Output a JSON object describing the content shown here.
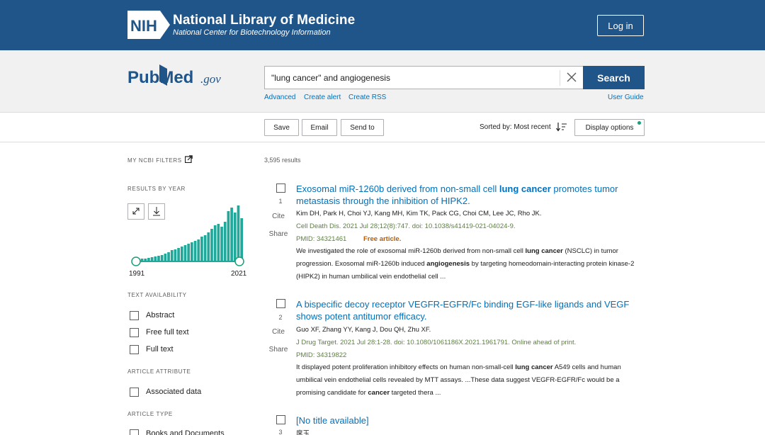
{
  "header": {
    "logo_text": "NIH",
    "title": "National Library of Medicine",
    "subtitle": "National Center for Biotechnology Information",
    "login_label": "Log in"
  },
  "search": {
    "logo_text": "PubMed",
    "logo_suffix": ".gov",
    "query": "\"lung cancer\" and angiogenesis",
    "button_label": "Search",
    "links": [
      "Advanced",
      "Create alert",
      "Create RSS"
    ],
    "user_guide": "User Guide"
  },
  "toolbar": {
    "save": "Save",
    "email": "Email",
    "send_to": "Send to",
    "sorted_by": "Sorted by: Most recent",
    "display_options": "Display options"
  },
  "sidebar": {
    "my_filters": "MY NCBI FILTERS",
    "results_by_year": "RESULTS BY YEAR",
    "year_start": "1991",
    "year_end": "2021",
    "text_availability": "TEXT AVAILABILITY",
    "text_options": [
      "Abstract",
      "Free full text",
      "Full text"
    ],
    "article_attribute": "ARTICLE ATTRIBUTE",
    "attribute_options": [
      "Associated data"
    ],
    "article_type": "ARTICLE TYPE",
    "type_options": [
      "Books and Documents"
    ]
  },
  "chart_data": {
    "type": "bar",
    "title": "",
    "series_color": "#20a89a",
    "values": [
      2,
      3,
      3,
      4,
      5,
      6,
      7,
      8,
      10,
      12,
      15,
      16,
      18,
      20,
      22,
      24,
      26,
      28,
      30,
      34,
      36,
      40,
      45,
      50,
      52,
      48,
      55,
      70,
      75,
      68,
      78,
      60
    ]
  },
  "results": {
    "count": "3,595 results",
    "cite": "Cite",
    "share": "Share",
    "free_article": "Free article.",
    "items": [
      {
        "num": "1",
        "title_pre": "Exosomal miR-1260b derived from non-small cell ",
        "title_bold": "lung cancer",
        "title_post": " promotes tumor metastasis through the inhibition of HIPK2.",
        "authors": "Kim DH, Park H, Choi YJ, Kang MH, Kim TK, Pack CG, Choi CM, Lee JC, Rho JK.",
        "citation": "Cell Death Dis. 2021 Jul 28;12(8):747. doi: 10.1038/s41419-021-04024-9.",
        "pmid": "PMID: 34321461",
        "snip_1": "We investigated the role of exosomal miR-1260b derived from non-small cell ",
        "snip_1b": "lung cancer",
        "snip_2": " (NSCLC) in tumor progression. Exosomal miR-1260b induced ",
        "snip_2b": "angiogenesis",
        "snip_3": " by targeting homeodomain-interacting protein kinase-2 (HIPK2) in human umbilical vein endothelial cell ..."
      },
      {
        "num": "2",
        "title": "A bispecific decoy receptor VEGFR-EGFR/Fc binding EGF-like ligands and VEGF shows potent antitumor efficacy.",
        "authors": "Guo XF, Zhang YY, Kang J, Dou QH, Zhu XF.",
        "citation": "J Drug Target. 2021 Jul 28:1-28. doi: 10.1080/1061186X.2021.1961791. Online ahead of print.",
        "pmid": "PMID: 34319822",
        "snip_1": "It displayed potent proliferation inhibitory effects on human non-small-cell ",
        "snip_1b": "lung cancer",
        "snip_2": " A549 cells and human umbilical vein endothelial cells revealed by MTT assays. ...These data suggest VEGFR-EGFR/Fc would be a promising candidate for ",
        "snip_2b": "cancer",
        "snip_3": " targeted thera ..."
      },
      {
        "num": "3",
        "title": "[No title available]",
        "authors": "席玉"
      }
    ]
  }
}
